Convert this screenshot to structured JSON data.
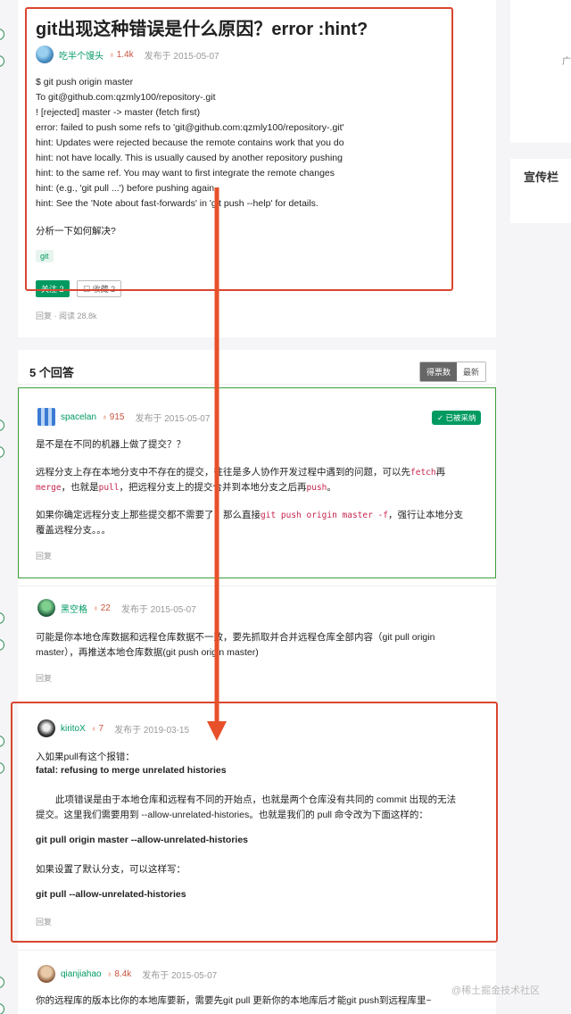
{
  "question": {
    "title": "git出现这种错误是什么原因？error :hint?",
    "author": "吃半个馒头",
    "reputation": "1.4k",
    "published": "发布于 2015-05-07",
    "body_lines": [
      "$ git push origin master",
      "To git@github.com:qzmly100/repository-.git",
      "! [rejected] master -> master (fetch first)",
      "error: failed to push some refs to 'git@github.com:qzmly100/repository-.git'",
      "hint: Updates were rejected because the remote contains work that you do",
      "hint: not have locally. This is usually caused by another repository pushing",
      "hint: to the same ref. You may want to first integrate the remote changes",
      "hint: (e.g., 'git pull ...') before pushing again.",
      "hint: See the 'Note about fast-forwards' in 'git push --help' for details."
    ],
    "question_line": "分析一下如何解决?",
    "tag": "git",
    "follow_label": "关注 2",
    "collect_label": "☐ 收藏 2",
    "stats": "回复 · 阅读 28.8k"
  },
  "sidebar": {
    "ad_char": "广",
    "title": "宣传栏"
  },
  "answers_header": {
    "count_label": "5 个回答",
    "tab_votes": "得票数",
    "tab_newest": "最新"
  },
  "answers": [
    {
      "author": "spacelan",
      "reputation": "915",
      "published": "发布于 2015-05-07",
      "accepted_label": "✓ 已被采纳",
      "line1": "是不是在不同的机器上做了提交？？",
      "line2_a": "远程分支上存在本地分支中不存在的提交，往往是多人协作开发过程中遇到的问题，可以先",
      "code_fetch": "fetch",
      "line2_b": "再",
      "code_merge": "merge",
      "line3_a": "，也就是",
      "code_pull": "pull",
      "line3_b": "，把远程分支上的提交合并到本地分支之后再",
      "code_push": "push",
      "line3_c": "。",
      "line4_a": "如果你确定远程分支上那些提交都不需要了，那么直接",
      "code_force": "git push origin master -f",
      "line4_b": "，强行让本地分支",
      "line5": "覆盖远程分支。。。",
      "reply": "回复"
    },
    {
      "author": "黑空格",
      "reputation": "22",
      "published": "发布于 2015-05-07",
      "line1": "可能是你本地仓库数据和远程仓库数据不一致，要先抓取并合并远程仓库全部内容（git pull origin",
      "line2": "master），再推送本地仓库数据(git push origin master)",
      "reply": "回复"
    },
    {
      "author": "kiritoX",
      "reputation": "7",
      "published": "发布于 2019-03-15",
      "line1": "入如果pull有这个报错：",
      "line2": "fatal: refusing to merge unrelated histories",
      "line3": "此项错误是由于本地仓库和远程有不同的开始点，也就是两个仓库没有共同的 commit 出现的无法",
      "line4": "提交。这里我们需要用到 --allow-unrelated-histories。也就是我们的 pull 命令改为下面这样的：",
      "line5": "git pull origin master --allow-unrelated-histories",
      "line6": "如果设置了默认分支，可以这样写：",
      "line7": "git pull --allow-unrelated-histories",
      "reply": "回复"
    },
    {
      "author": "qianjiahao",
      "reputation": "8.4k",
      "published": "发布于 2015-05-07",
      "line1": "你的远程库的版本比你的本地库要新，需要先git pull 更新你的本地库后才能git push到远程库里~"
    }
  ],
  "watermark": "@稀土掘金技术社区",
  "colors": {
    "annotation_red": "#d9462f",
    "accepted_green": "#009a61",
    "card_bg": "#ffffff",
    "page_bg": "#f5f5f7"
  }
}
